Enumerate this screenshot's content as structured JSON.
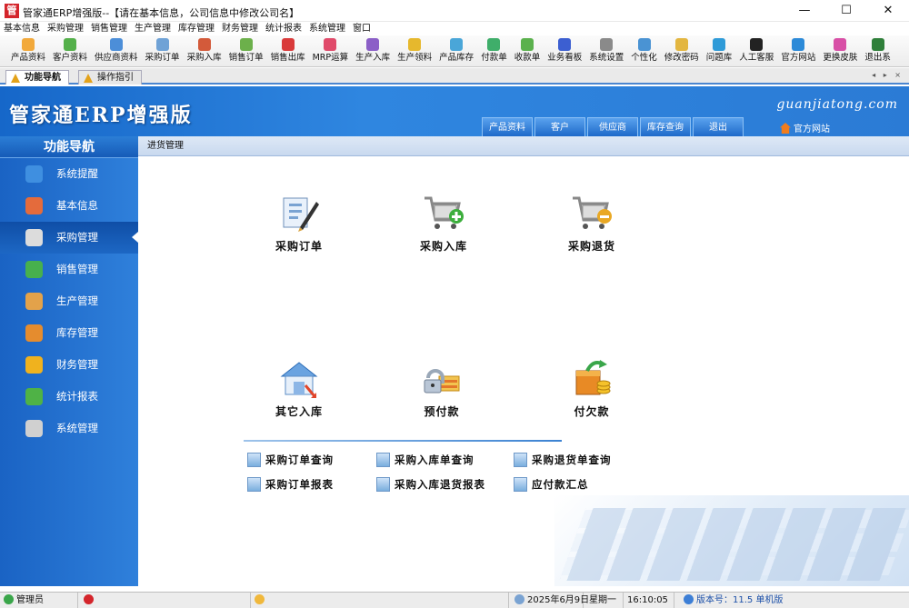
{
  "window": {
    "title": "管家通ERP增强版--【请在基本信息，公司信息中修改公司名】",
    "min": "—",
    "max": "☐",
    "close": "✕"
  },
  "menu": [
    "基本信息",
    "采购管理",
    "销售管理",
    "生产管理",
    "库存管理",
    "财务管理",
    "统计报表",
    "系统管理",
    "窗口"
  ],
  "toolbar": [
    {
      "label": "产品资料",
      "color": "#f2a93b"
    },
    {
      "label": "客户资料",
      "color": "#54b04a"
    },
    {
      "label": "供应商资料",
      "color": "#4c8ed8"
    },
    {
      "label": "采购订单",
      "color": "#6fa2d6"
    },
    {
      "label": "采购入库",
      "color": "#d35a3a"
    },
    {
      "label": "销售订单",
      "color": "#6cb04b"
    },
    {
      "label": "销售出库",
      "color": "#d93a3a"
    },
    {
      "label": "MRP运算",
      "color": "#e04a6a"
    },
    {
      "label": "生产入库",
      "color": "#8b5fc7"
    },
    {
      "label": "生产领料",
      "color": "#e6b82d"
    },
    {
      "label": "产品库存",
      "color": "#4aa6d8"
    },
    {
      "label": "付款单",
      "color": "#3fae6a"
    },
    {
      "label": "收款单",
      "color": "#5bb14d"
    },
    {
      "label": "业务看板",
      "color": "#3c5fd1"
    },
    {
      "label": "系统设置",
      "color": "#8a8a8a"
    },
    {
      "label": "个性化",
      "color": "#4a93d3"
    },
    {
      "label": "修改密码",
      "color": "#e3b640"
    },
    {
      "label": "问题库",
      "color": "#2f9bd8"
    },
    {
      "label": "人工客服",
      "color": "#222222"
    },
    {
      "label": "官方网站",
      "color": "#2c8ad8"
    },
    {
      "label": "更换皮肤",
      "color": "#d84fa6"
    },
    {
      "label": "退出系",
      "color": "#2f7f3a"
    }
  ],
  "tabs": [
    {
      "label": "功能导航",
      "active": true
    },
    {
      "label": "操作指引",
      "active": false
    }
  ],
  "tab_arrows": "◂ ▸ ×",
  "banner": {
    "brand": "管家通ERP增强版",
    "url": "guanjiatong.com",
    "nav": [
      "产品资料",
      "客户",
      "供应商",
      "库存查询",
      "退出"
    ],
    "official": "官方网站"
  },
  "sidebar": {
    "title": "功能导航",
    "items": [
      {
        "label": "系统提醒",
        "color": "#3f8fe0"
      },
      {
        "label": "基本信息",
        "color": "#e46b3c"
      },
      {
        "label": "采购管理",
        "color": "#dcdcdc"
      },
      {
        "label": "销售管理",
        "color": "#47b04d"
      },
      {
        "label": "生产管理",
        "color": "#e3a24a"
      },
      {
        "label": "库存管理",
        "color": "#e58c2e"
      },
      {
        "label": "财务管理",
        "color": "#f0b21e"
      },
      {
        "label": "统计报表",
        "color": "#4fb246"
      },
      {
        "label": "系统管理",
        "color": "#d0d0d0"
      }
    ],
    "active_index": 2
  },
  "content": {
    "breadcrumb": "进货管理",
    "functions": [
      {
        "label": "采购订单",
        "icon": "purchase-order-icon"
      },
      {
        "label": "采购入库",
        "icon": "cart-add-icon"
      },
      {
        "label": "采购退货",
        "icon": "cart-remove-icon"
      },
      {
        "label": "其它入库",
        "icon": "warehouse-in-icon"
      },
      {
        "label": "预付款",
        "icon": "lock-money-icon"
      },
      {
        "label": "付欠款",
        "icon": "coins-icon"
      }
    ],
    "links": [
      "采购订单查询",
      "采购入库单查询",
      "采购退货单查询",
      "采购订单报表",
      "采购入库退货报表",
      "应付款汇总"
    ]
  },
  "status": {
    "user": "管理员",
    "date": "2025年6月9日",
    "weekday": "星期一",
    "time": "16:10:05",
    "version": "版本号：11.5 单机版"
  }
}
